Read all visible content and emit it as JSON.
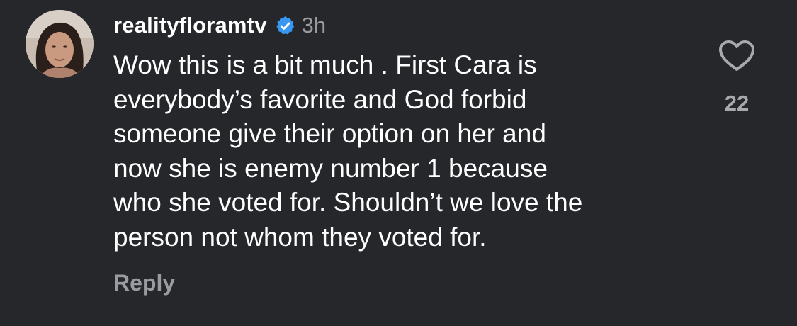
{
  "comment": {
    "username": "realityfloramtv",
    "verified_icon": "verified-badge-icon",
    "timestamp": "3h",
    "text": "Wow this is a bit much . First Cara is\neverybody’s favorite and God forbid\nsomeone give their option on her and\nnow she is enemy number 1 because\nwho she voted for. Shouldn’t we love the\nperson not whom they voted for.",
    "reply_label": "Reply",
    "like_icon": "heart-outline-icon",
    "like_count": "22"
  },
  "colors": {
    "background": "#25272b",
    "text": "#ffffff",
    "secondary_text": "#9a9ba0",
    "verified_blue": "#3897f0"
  }
}
